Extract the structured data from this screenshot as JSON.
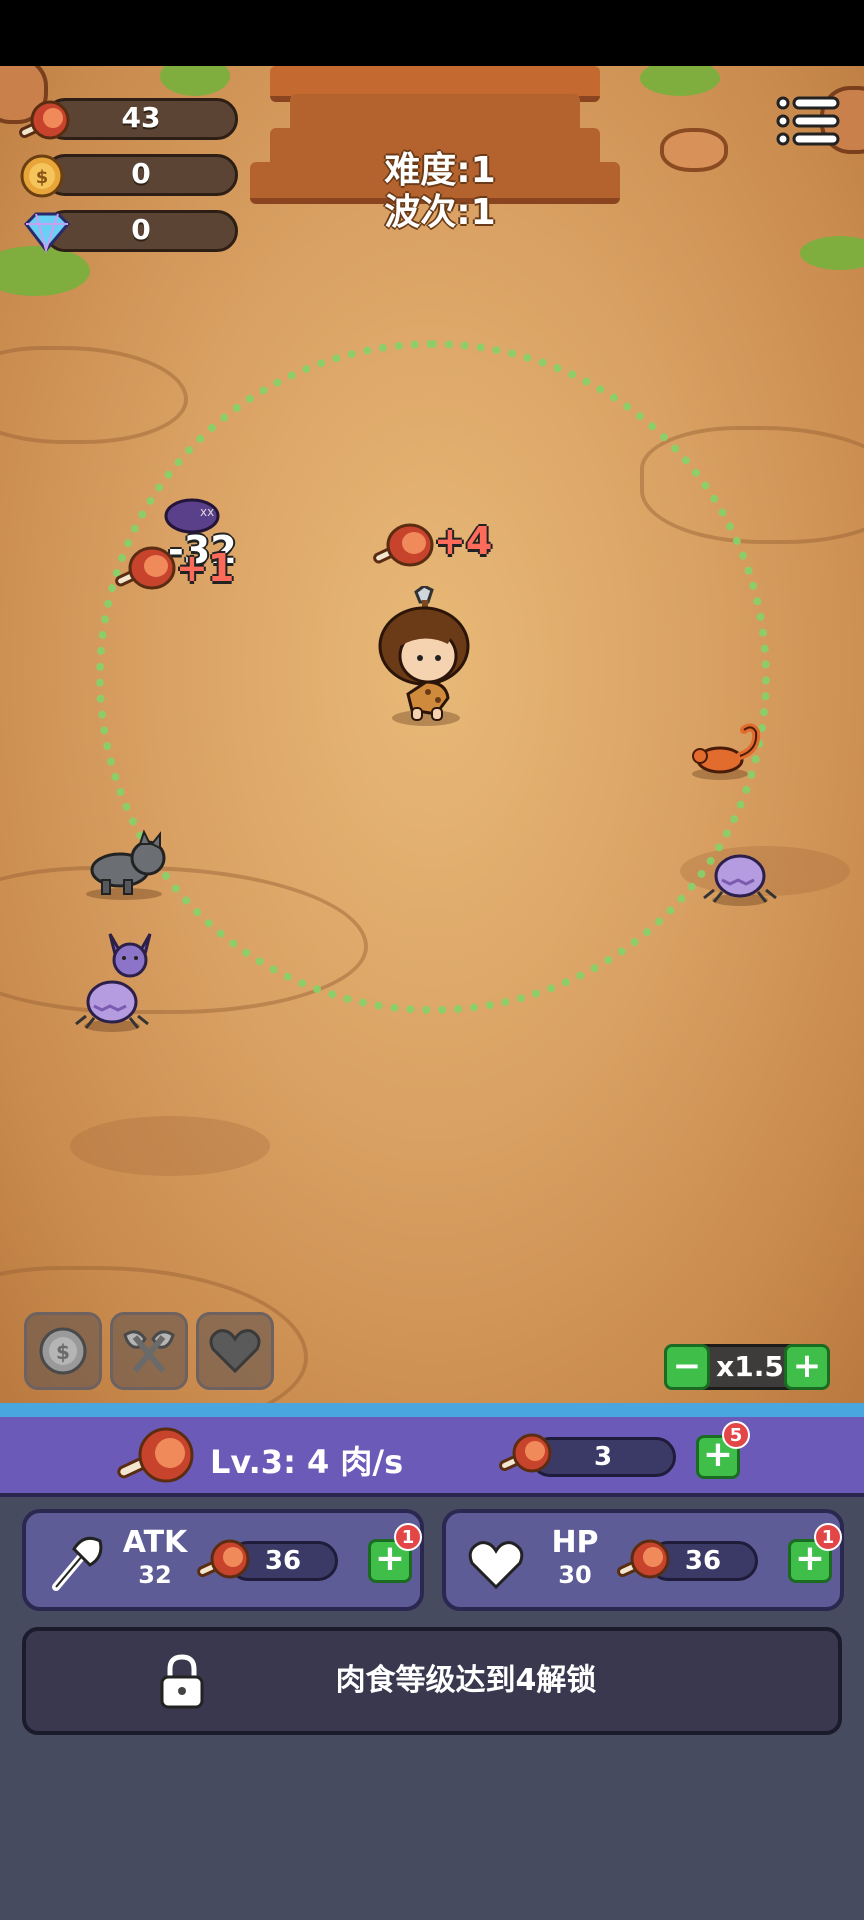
{
  "hud": {
    "meat_count": "43",
    "coin_count": "0",
    "gem_count": "0",
    "difficulty": "难度:1",
    "wave": "波次:1"
  },
  "floating_texts": {
    "meat_gain_main": "+4",
    "damage": "-32",
    "meat_gain_side": "+1"
  },
  "controls": {
    "speed": "x1.5",
    "minus": "−",
    "plus": "+"
  },
  "upgrade_panel": {
    "meat_level": "Lv.3: 4 肉/s",
    "meat_cost": "3",
    "meat_badge": "5",
    "atk": {
      "name": "ATK",
      "value": "32",
      "cost": "36",
      "badge": "1"
    },
    "hp": {
      "name": "HP",
      "value": "30",
      "cost": "36",
      "badge": "1"
    },
    "locked_text": "肉食等级达到4解锁"
  },
  "colors": {
    "accent_green": "#3fbf4a",
    "panel_purple": "#6b5ab8",
    "range_ring": "#86d36b",
    "badge_red": "#e24646"
  }
}
